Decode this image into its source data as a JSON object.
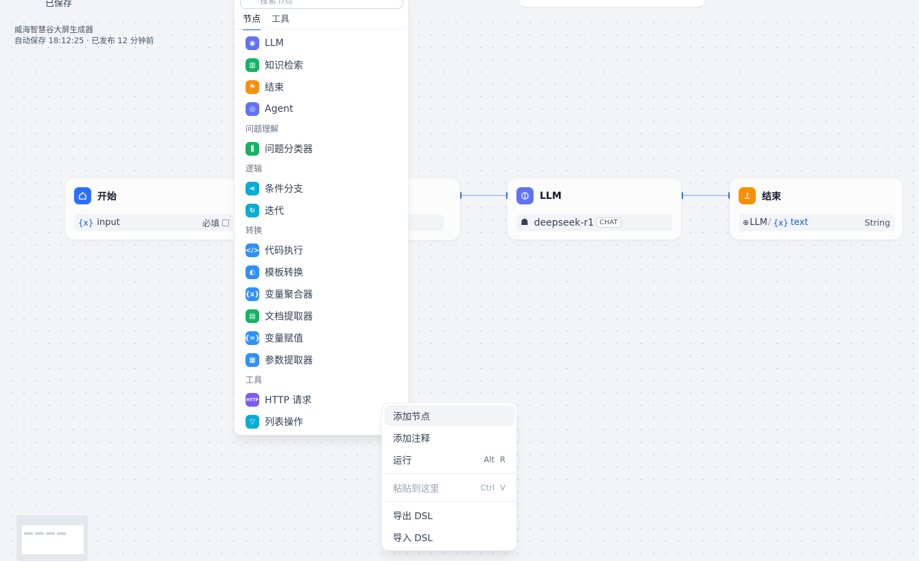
{
  "topbar": {
    "crumb_left": "已保存",
    "pill_text": ""
  },
  "app": {
    "name": "威海智慧谷大屏生成器",
    "status": "自动保存 18:12:25 · 已发布 12 分钟前"
  },
  "nodes": {
    "start": {
      "title": "开始",
      "var_icon": "{x}",
      "var_name": "input",
      "required": "必填"
    },
    "llm": {
      "title": "LLM",
      "model": "deepseek-r1",
      "badge": "CHAT"
    },
    "end": {
      "title": "结束",
      "source": "LLM",
      "var_icon": "{x}",
      "var_name": "text",
      "type": "String"
    }
  },
  "blocks_panel": {
    "search_placeholder": "搜索节点",
    "tabs": [
      "节点",
      "工具"
    ],
    "items": [
      {
        "label": "LLM",
        "icon": "brain-icon",
        "color": "#6172f3"
      },
      {
        "label": "知识检索",
        "icon": "book-icon",
        "color": "#16b364"
      },
      {
        "label": "结束",
        "icon": "flag-icon",
        "color": "#f79009"
      },
      {
        "label": "Agent",
        "icon": "agent-icon",
        "color": "#6172f3"
      },
      {
        "label": "问题分类器",
        "icon": "classifier-icon",
        "color": "#16b364"
      },
      {
        "label": "条件分支",
        "icon": "branch-icon",
        "color": "#06aed4"
      },
      {
        "label": "迭代",
        "icon": "loop-icon",
        "color": "#06aed4"
      },
      {
        "label": "代码执行",
        "icon": "code-icon",
        "color": "#2e90fa"
      },
      {
        "label": "模板转换",
        "icon": "template-icon",
        "color": "#2e90fa"
      },
      {
        "label": "变量聚合器",
        "icon": "variable-icon",
        "color": "#2e90fa"
      },
      {
        "label": "文档提取器",
        "icon": "document-icon",
        "color": "#16b364"
      },
      {
        "label": "变量赋值",
        "icon": "assign-icon",
        "color": "#2e90fa"
      },
      {
        "label": "参数提取器",
        "icon": "param-icon",
        "color": "#2e90fa"
      },
      {
        "label": "HTTP 请求",
        "icon": "http-icon",
        "color": "#7a5af8"
      },
      {
        "label": "列表操作",
        "icon": "filter-icon",
        "color": "#06aed4"
      }
    ],
    "groups": [
      "问题理解",
      "逻辑",
      "转换",
      "工具"
    ]
  },
  "context_menu": {
    "add_node": "添加节点",
    "add_note": "添加注释",
    "run": "运行",
    "run_shortcut": [
      "Alt",
      "R"
    ],
    "paste": "粘贴到这里",
    "paste_shortcut": [
      "Ctrl",
      "V"
    ],
    "export": "导出 DSL",
    "import": "导入 DSL"
  }
}
